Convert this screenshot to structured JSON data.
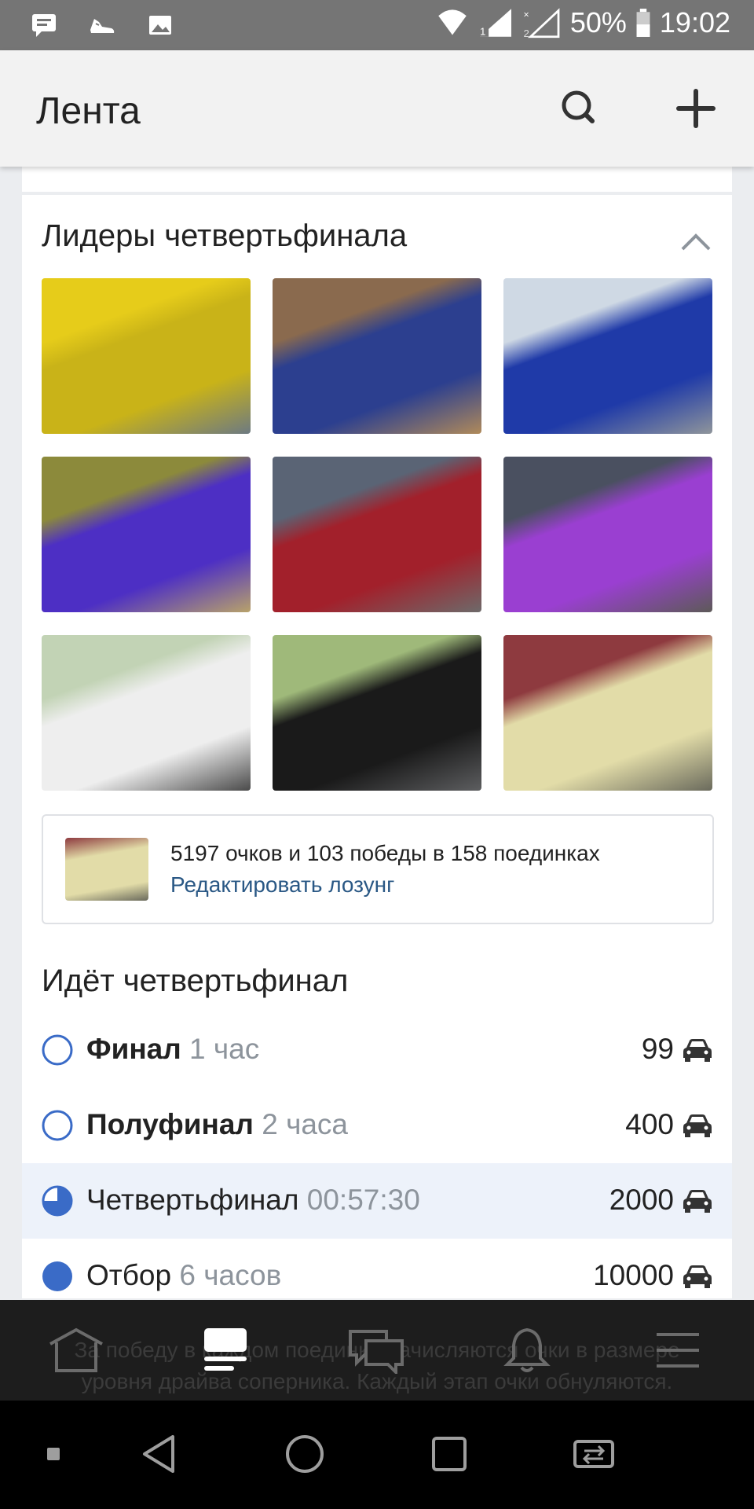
{
  "status_bar": {
    "battery_percent": "50%",
    "time": "19:02",
    "icons": [
      "message-icon",
      "sneaker-icon",
      "image-icon",
      "wifi-icon",
      "signal-sim1-icon",
      "signal-sim2-icon",
      "battery-icon"
    ]
  },
  "header": {
    "title": "Лента",
    "search_icon": "search-icon",
    "add_icon": "plus-icon"
  },
  "leaders": {
    "title": "Лидеры четвертьфинала",
    "collapse_icon": "chevron-up-icon",
    "photos": [
      {
        "name": "photo-yellow-car",
        "colors": [
          "#e6cc1a",
          "#c9b318",
          "#6d7a82"
        ]
      },
      {
        "name": "photo-blue-bmw",
        "colors": [
          "#8a6a4e",
          "#2c3f8f",
          "#b08a5a"
        ]
      },
      {
        "name": "photo-blue-coupe",
        "colors": [
          "#cfd9e4",
          "#1f3aa8",
          "#8f959b"
        ]
      },
      {
        "name": "photo-purple-skyline",
        "colors": [
          "#8c8a3b",
          "#4d2fc4",
          "#b8a26a"
        ]
      },
      {
        "name": "photo-red-subaru",
        "colors": [
          "#5a6475",
          "#a2202b",
          "#6d6a6a"
        ]
      },
      {
        "name": "photo-purple-volga",
        "colors": [
          "#4a5060",
          "#9a3fd1",
          "#5d5a58"
        ]
      },
      {
        "name": "photo-white-toyota",
        "colors": [
          "#c2d3b5",
          "#eeeeee",
          "#4a4a4a"
        ]
      },
      {
        "name": "photo-drift-car",
        "colors": [
          "#9fb97a",
          "#1a1a1a",
          "#5d5e60"
        ]
      },
      {
        "name": "photo-beige-moskvich",
        "colors": [
          "#8e3a3f",
          "#e2dca8",
          "#6a6a5c"
        ]
      }
    ],
    "stats": {
      "line": "5197 очков и 103 победы в 158 поединках",
      "link": "Редактировать лозунг"
    }
  },
  "stages": {
    "title": "Идёт четвертьфинал",
    "items": [
      {
        "name": "Финал",
        "time": "1 час",
        "points": "99",
        "status": "pending"
      },
      {
        "name": "Полуфинал",
        "time": "2 часа",
        "points": "400",
        "status": "pending"
      },
      {
        "name": "Четвертьфинал",
        "time": "00:57:30",
        "points": "2000",
        "status": "active",
        "progress": 0.75
      },
      {
        "name": "Отбор",
        "time": "6 часов",
        "points": "10000",
        "status": "done"
      }
    ],
    "note_lines": [
      "За победу в каждом поединке начисляются очки в размере",
      "уровня драйва соперника. Каждый этап очки обнуляются."
    ]
  },
  "tabbar": {
    "icons": [
      "home-icon",
      "feed-icon",
      "messages-icon",
      "notifications-icon",
      "menu-icon"
    ],
    "active_index": 1
  },
  "system_nav": {
    "icons": [
      "recents-dot-icon",
      "back-icon",
      "home-circle-icon",
      "overview-icon",
      "switch-sim-icon"
    ]
  },
  "colors": {
    "accent": "#2a5885",
    "stage_blue": "#3a6bc7",
    "active_row": "#edf2fa"
  }
}
